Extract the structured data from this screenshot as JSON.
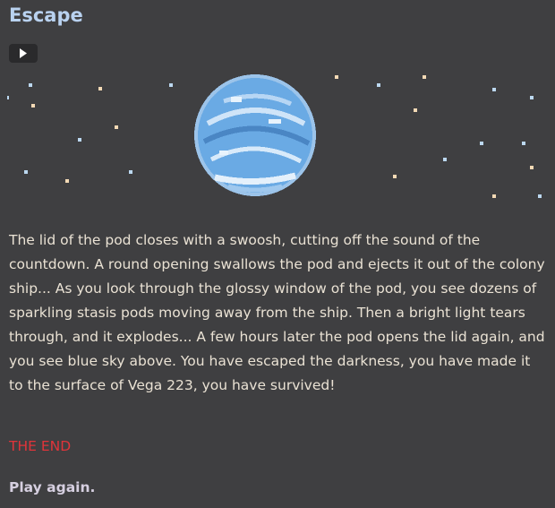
{
  "game": {
    "title": "Escape",
    "controls": {
      "play_icon": "play-icon"
    },
    "story": "The lid of the pod closes with a swoosh, cutting off the sound of the countdown. A round opening swallows the pod and ejects it out of the colony ship... As you look through the glossy window of the pod, you see dozens of sparkling stasis pods moving away from the ship. Then a bright light tears through, and it explodes... A few hours later the pod opens the lid again, and you see blue sky above. You have escaped the darkness, you have made it to the surface of Vega 223, you have survived!",
    "ending": "THE END",
    "restart_label": "Play again."
  },
  "colors": {
    "background": "#3f3f41",
    "title": "#b9d2f0",
    "ending": "#e0343a",
    "text": "#eae2d4",
    "star_blue": "#bcd8f0",
    "star_peach": "#f3d9b5",
    "planet": "#6aaae4"
  }
}
